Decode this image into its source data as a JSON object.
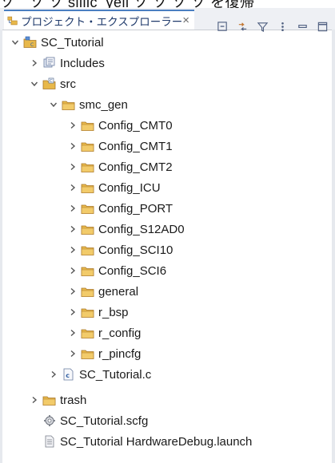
{
  "top_strip_text": "ソ＿ソ ソ sillic_yeii ソ ソ ソ ソ を復帰",
  "panel": {
    "tab_title": "プロジェクト・エクスプローラー",
    "close_glyph": "×"
  },
  "tree": [
    {
      "label": "SC_Tutorial",
      "icon": "project-icon",
      "expanded": true
    },
    {
      "label": "Includes",
      "icon": "includes-icon",
      "expanded": false
    },
    {
      "label": "src",
      "icon": "source-folder-icon",
      "expanded": true
    },
    {
      "label": "smc_gen",
      "icon": "folder-icon",
      "expanded": true
    },
    {
      "label": "Config_CMT0",
      "icon": "folder-icon",
      "expanded": false
    },
    {
      "label": "Config_CMT1",
      "icon": "folder-icon",
      "expanded": false
    },
    {
      "label": "Config_CMT2",
      "icon": "folder-icon",
      "expanded": false
    },
    {
      "label": "Config_ICU",
      "icon": "folder-icon",
      "expanded": false
    },
    {
      "label": "Config_PORT",
      "icon": "folder-icon",
      "expanded": false
    },
    {
      "label": "Config_S12AD0",
      "icon": "folder-icon",
      "expanded": false
    },
    {
      "label": "Config_SCI10",
      "icon": "folder-icon",
      "expanded": false
    },
    {
      "label": "Config_SCI6",
      "icon": "folder-icon",
      "expanded": false
    },
    {
      "label": "general",
      "icon": "folder-icon",
      "expanded": false
    },
    {
      "label": "r_bsp",
      "icon": "folder-icon",
      "expanded": false
    },
    {
      "label": "r_config",
      "icon": "folder-icon",
      "expanded": false
    },
    {
      "label": "r_pincfg",
      "icon": "folder-icon",
      "expanded": false
    },
    {
      "label": "SC_Tutorial.c",
      "icon": "c-file-icon",
      "expanded": false
    },
    {
      "label": "trash",
      "icon": "folder-icon",
      "expanded": false
    },
    {
      "label": "SC_Tutorial.scfg",
      "icon": "gear-file-icon",
      "expanded": null
    },
    {
      "label": "SC_Tutorial HardwareDebug.launch",
      "icon": "launch-file-icon",
      "expanded": null
    }
  ],
  "colors": {
    "tab_accent": "#4a7fc1",
    "folder": "#e8b84a",
    "chevron": "#555555"
  }
}
